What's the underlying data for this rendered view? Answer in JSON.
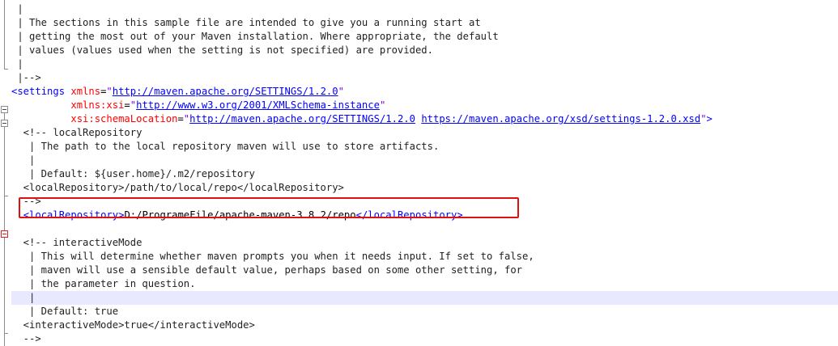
{
  "lines": [
    {
      "comment": " |"
    },
    {
      "comment": " | The sections in this sample file are intended to give you a running start at"
    },
    {
      "comment": " | getting the most out of your Maven installation. Where appropriate, the default"
    },
    {
      "comment": " | values (values used when the setting is not specified) are provided."
    },
    {
      "comment": " |"
    },
    {
      "comment": " |-->"
    },
    {
      "settings_open": {
        "tag": "settings",
        "attr": "xmlns",
        "url": "http://maven.apache.org/SETTINGS/1.2.0"
      }
    },
    {
      "xsi": {
        "attr": "xmlns:xsi",
        "url": "http://www.w3.org/2001/XMLSchema-instance"
      }
    },
    {
      "schema": {
        "attr": "xsi:schemaLocation",
        "url1": "http://maven.apache.org/SETTINGS/1.2.0",
        "url2": "https://maven.apache.org/xsd/settings-1.2.0.xsd"
      }
    },
    {
      "comment": "  <!-- localRepository"
    },
    {
      "comment": "   | The path to the local repository maven will use to store artifacts."
    },
    {
      "comment": "   |"
    },
    {
      "comment": "   | Default: ${user.home}/.m2/repository"
    },
    {
      "comment": "  <localRepository>/path/to/local/repo</localRepository>"
    },
    {
      "comment": "  -->"
    },
    {
      "element": {
        "tag": "localRepository",
        "value": "D:/ProgrameFile/apache-maven-3.8.2/repo"
      }
    },
    {
      "comment": ""
    },
    {
      "comment": "  <!-- interactiveMode"
    },
    {
      "comment": "   | This will determine whether maven prompts you when it needs input. If set to false,"
    },
    {
      "comment": "   | maven will use a sensible default value, perhaps based on some other setting, for"
    },
    {
      "comment": "   | the parameter in question."
    },
    {
      "comment": "   |"
    },
    {
      "comment": "   | Default: true"
    },
    {
      "comment": "  <interactiveMode>true</interactiveMode>"
    },
    {
      "comment": "  -->"
    }
  ],
  "colors": {
    "tag": "#0000ff",
    "attribute": "#ff0000",
    "string": "#8000ff",
    "highlight_box": "#e01010",
    "current_line": "#e8e8ff"
  }
}
